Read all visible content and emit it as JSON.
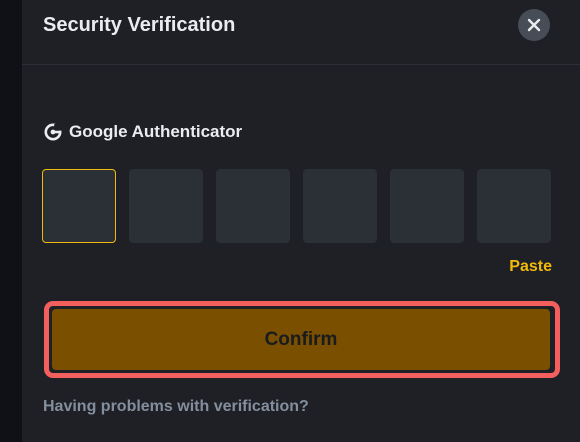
{
  "dialog": {
    "title": "Security Verification",
    "close_icon": "close-icon"
  },
  "authenticator": {
    "icon": "google-g-icon",
    "label": "Google Authenticator",
    "code_digits": [
      "",
      "",
      "",
      "",
      "",
      ""
    ]
  },
  "actions": {
    "paste_label": "Paste",
    "confirm_label": "Confirm",
    "help_link": "Having problems with verification?"
  },
  "colors": {
    "accent": "#f0b90b",
    "confirm_bg": "#7a5000",
    "highlight_outline": "#f25f5c",
    "panel_bg": "#1e2026",
    "input_bg": "#2b2f36"
  }
}
